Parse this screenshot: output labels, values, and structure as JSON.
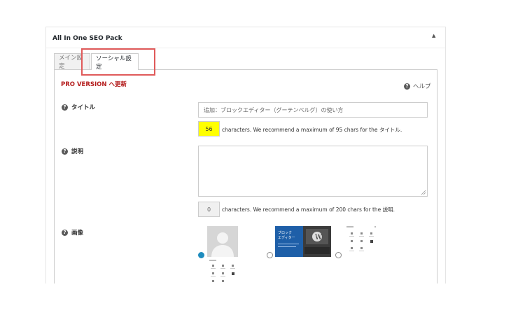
{
  "panel": {
    "title": "All In One SEO Pack",
    "toggle_icon": "triangle-up-icon"
  },
  "tabs": [
    {
      "label": "メイン設定",
      "active": false
    },
    {
      "label": "ソーシャル設定",
      "active": true
    }
  ],
  "highlight_color": "#e05a5a",
  "pro_link": "PRO VERSION へ更新",
  "help": {
    "label": "ヘルプ",
    "icon": "question-circle-icon"
  },
  "fields": {
    "title": {
      "label": "タイトル",
      "value": "追加：ブロックエディター（グーテンベルグ）の使い方",
      "count": "56",
      "hint": "characters. We recommend a maximum of 95 chars for the タイトル."
    },
    "description": {
      "label": "説明",
      "value": "",
      "count": "0",
      "hint": "characters. We recommend a maximum of 200 chars for the 説明."
    },
    "image": {
      "label": "画像",
      "options": [
        {
          "name": "default-avatar",
          "selected": true
        },
        {
          "name": "block-editor-thumbnail",
          "selected": false,
          "text_line1": "ブロック",
          "text_line2": "エディター"
        },
        {
          "name": "editor-screenshot",
          "selected": false
        }
      ]
    }
  },
  "colors": {
    "pro_link": "#b41c1c",
    "count_highlight": "#ffff00",
    "radio_selected": "#1e8cbe"
  }
}
